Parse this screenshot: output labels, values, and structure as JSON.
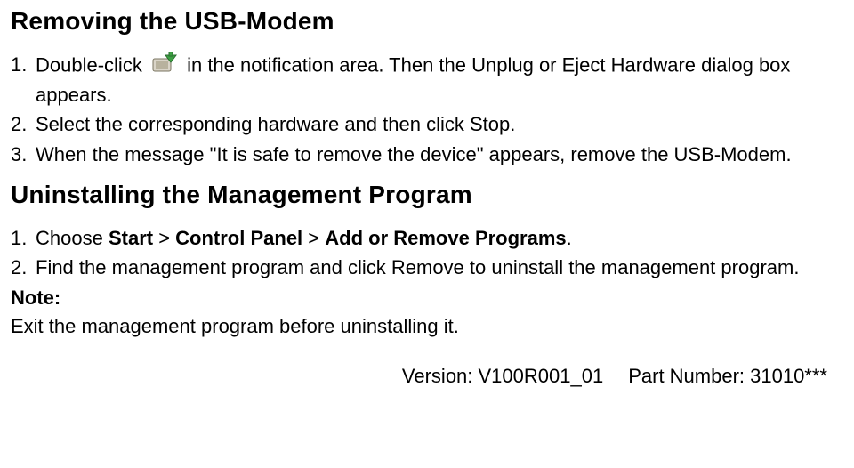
{
  "section1": {
    "heading": "Removing the USB-Modem",
    "items": [
      {
        "marker": "1.",
        "pre": "Double-click",
        "post": "in the notification area. Then the Unplug or Eject Hardware dialog box appears."
      },
      {
        "marker": "2.",
        "text": "Select the corresponding hardware and then click Stop."
      },
      {
        "marker": "3.",
        "text": "When the message \"It is safe to remove the device\" appears, remove the USB-Modem."
      }
    ]
  },
  "section2": {
    "heading": "Uninstalling the Management Program",
    "items": [
      {
        "marker": "1.",
        "lead": "Choose ",
        "b1": "Start",
        "sep1": " > ",
        "b2": "Control Panel",
        "sep2": " > ",
        "b3": "Add or Remove Programs",
        "tail": "."
      },
      {
        "marker": "2.",
        "text": "Find the management program and click Remove to uninstall the management program."
      }
    ],
    "note_label": "Note:",
    "note_text": "Exit the management program before uninstalling it."
  },
  "footer": {
    "version": "Version: V100R001_01",
    "part": "Part Number: 31010***"
  },
  "icons": {
    "unplug_eject": "unplug-eject-icon"
  }
}
